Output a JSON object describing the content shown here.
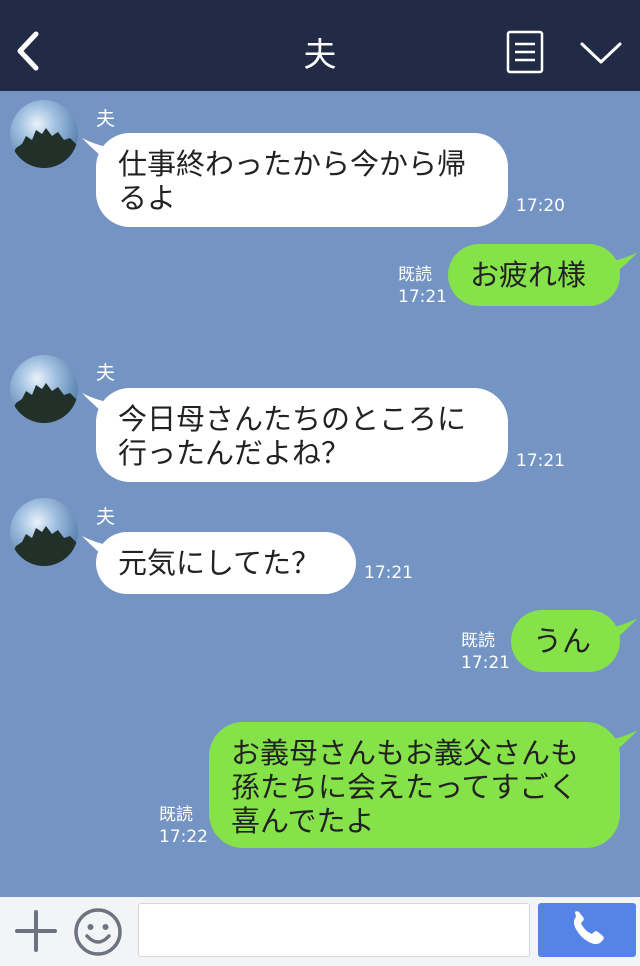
{
  "header": {
    "title": "夫",
    "back_icon": "chevron-left-icon",
    "notes_icon": "notes-icon",
    "menu_icon": "chevron-down-icon"
  },
  "messages": [
    {
      "direction": "in",
      "sender": "夫",
      "text": "仕事終わったから今から帰\nるよ",
      "time": "17:20"
    },
    {
      "direction": "out",
      "text": "お疲れ様",
      "read": "既読",
      "time": "17:21"
    },
    {
      "direction": "in",
      "sender": "夫",
      "text": "今日母さんたちのところに\n行ったんだよね？",
      "time": "17:21"
    },
    {
      "direction": "in",
      "sender": "夫",
      "text": "元気にしてた？",
      "time": "17:21"
    },
    {
      "direction": "out",
      "text": "うん",
      "read": "既読",
      "time": "17:21"
    },
    {
      "direction": "out",
      "text": "お義母さんもお義父さんも\n孫たちに会えたってすごく\n喜んでたよ",
      "read": "既読",
      "time": "17:22"
    }
  ],
  "input": {
    "placeholder": "",
    "value": ""
  },
  "colors": {
    "header_bg": "#222b45",
    "chat_bg": "#7494c4",
    "incoming_bubble": "#ffffff",
    "outgoing_bubble": "#85e249",
    "call_button": "#5583e6"
  }
}
